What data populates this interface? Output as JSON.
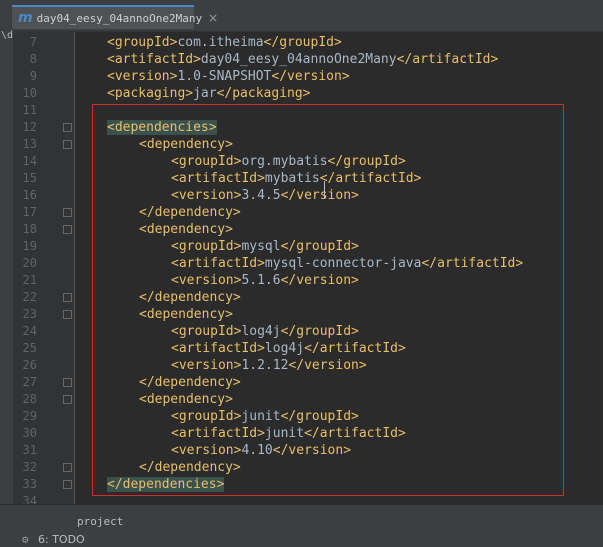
{
  "tab": {
    "icon": "m",
    "title": "day04_eesy_04annoOne2Many",
    "close": "×"
  },
  "project_strip": {
    "label": "\\da"
  },
  "lines": [
    {
      "num": "7",
      "text": "<groupId>com.itheima</groupId>",
      "indent": 0,
      "fold": false
    },
    {
      "num": "8",
      "text": "<artifactId>day04_eesy_04annoOne2Many</artifactId>",
      "indent": 0,
      "fold": false
    },
    {
      "num": "9",
      "text": "<version>1.0-SNAPSHOT</version>",
      "indent": 0,
      "fold": false
    },
    {
      "num": "10",
      "text": "<packaging>jar</packaging>",
      "indent": 0,
      "fold": false
    },
    {
      "num": "11",
      "text": "",
      "indent": 0,
      "fold": false
    },
    {
      "num": "12",
      "text": "<dependencies>",
      "indent": 0,
      "fold": true,
      "highlight": true
    },
    {
      "num": "13",
      "text": "<dependency>",
      "indent": 1,
      "fold": true
    },
    {
      "num": "14",
      "text": "<groupId>org.mybatis</groupId>",
      "indent": 2,
      "fold": false
    },
    {
      "num": "15",
      "text": "<artifactId>mybatis</artifactId>",
      "indent": 2,
      "fold": false
    },
    {
      "num": "16",
      "text": "<version>3.4.5</version>",
      "indent": 2,
      "fold": false
    },
    {
      "num": "17",
      "text": "</dependency>",
      "indent": 1,
      "fold": true
    },
    {
      "num": "18",
      "text": "<dependency>",
      "indent": 1,
      "fold": true
    },
    {
      "num": "19",
      "text": "<groupId>mysql</groupId>",
      "indent": 2,
      "fold": false
    },
    {
      "num": "20",
      "text": "<artifactId>mysql-connector-java</artifactId>",
      "indent": 2,
      "fold": false
    },
    {
      "num": "21",
      "text": "<version>5.1.6</version>",
      "indent": 2,
      "fold": false
    },
    {
      "num": "22",
      "text": "</dependency>",
      "indent": 1,
      "fold": true
    },
    {
      "num": "23",
      "text": "<dependency>",
      "indent": 1,
      "fold": true
    },
    {
      "num": "24",
      "text": "<groupId>log4j</groupId>",
      "indent": 2,
      "fold": false
    },
    {
      "num": "25",
      "text": "<artifactId>log4j</artifactId>",
      "indent": 2,
      "fold": false
    },
    {
      "num": "26",
      "text": "<version>1.2.12</version>",
      "indent": 2,
      "fold": false
    },
    {
      "num": "27",
      "text": "</dependency>",
      "indent": 1,
      "fold": true
    },
    {
      "num": "28",
      "text": "<dependency>",
      "indent": 1,
      "fold": true
    },
    {
      "num": "29",
      "text": "<groupId>junit</groupId>",
      "indent": 2,
      "fold": false
    },
    {
      "num": "30",
      "text": "<artifactId>junit</artifactId>",
      "indent": 2,
      "fold": false
    },
    {
      "num": "31",
      "text": "<version>4.10</version>",
      "indent": 2,
      "fold": false
    },
    {
      "num": "32",
      "text": "</dependency>",
      "indent": 1,
      "fold": true
    },
    {
      "num": "33",
      "text": "</dependencies>",
      "indent": 0,
      "fold": true,
      "highlight": true
    },
    {
      "num": "34",
      "text": "",
      "indent": 0,
      "fold": false
    }
  ],
  "bottom": {
    "project_label": "project",
    "todo_label": "6: TODO"
  },
  "colors": {
    "tag": "#e8bf6a",
    "text": "#a9b7c6",
    "selection_border": "#d32b2b",
    "tag_highlight": "#3b514d"
  },
  "icons": {
    "tab_icon": "maven-icon",
    "fold_icon": "fold-marker-icon",
    "todo_icon": "todo-icon"
  }
}
